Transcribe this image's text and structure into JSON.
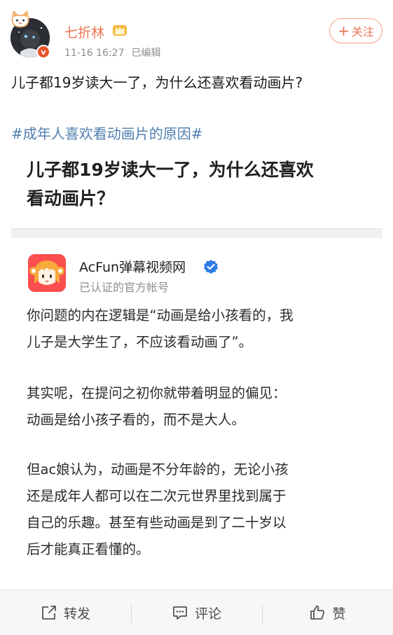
{
  "post": {
    "author": {
      "name": "七折林",
      "badge_letter": "v",
      "vip_icon": "crown-icon"
    },
    "meta": {
      "time": "11-16 16:27",
      "edited": "已编辑"
    },
    "follow_button": {
      "icon": "plus-icon",
      "label": "关注"
    },
    "text": "儿子都19岁读大一了，为什么还喜欢看动画片?",
    "hashtag": "#成年人喜欢看动画片的原因#"
  },
  "embed": {
    "title_lines": [
      "儿子都19岁读大一了，为什么还喜欢",
      "看动画片？"
    ],
    "answerer": {
      "name": "AcFun弹幕视频网",
      "verified_icon": "verified-check-icon",
      "subtitle": "已认证的官方帐号"
    },
    "paragraphs": [
      [
        "你问题的内在逻辑是“动画是给小孩看的，我",
        "儿子是大学生了，不应该看动画了”。"
      ],
      [
        "其实呢，在提问之初你就带着明显的偏见：",
        "动画是给小孩子看的，而不是大人。"
      ],
      [
        "但ac娘认为，动画是不分年龄的，无论小孩",
        "还是成年人都可以在二次元世界里找到属于",
        "自己的乐趣。甚至有些动画是到了二十岁以",
        "后才能真正看懂的。"
      ]
    ]
  },
  "footer": {
    "repost": {
      "label": "转发",
      "icon": "repost-icon"
    },
    "comment": {
      "label": "评论",
      "icon": "comment-icon"
    },
    "like": {
      "label": "赞",
      "icon": "thumbs-up-icon"
    }
  },
  "colors": {
    "accent": "#eb7350",
    "hashtag": "#507daf",
    "acfun_red": "#fb4e4e",
    "verified_blue": "#2d7be5"
  }
}
